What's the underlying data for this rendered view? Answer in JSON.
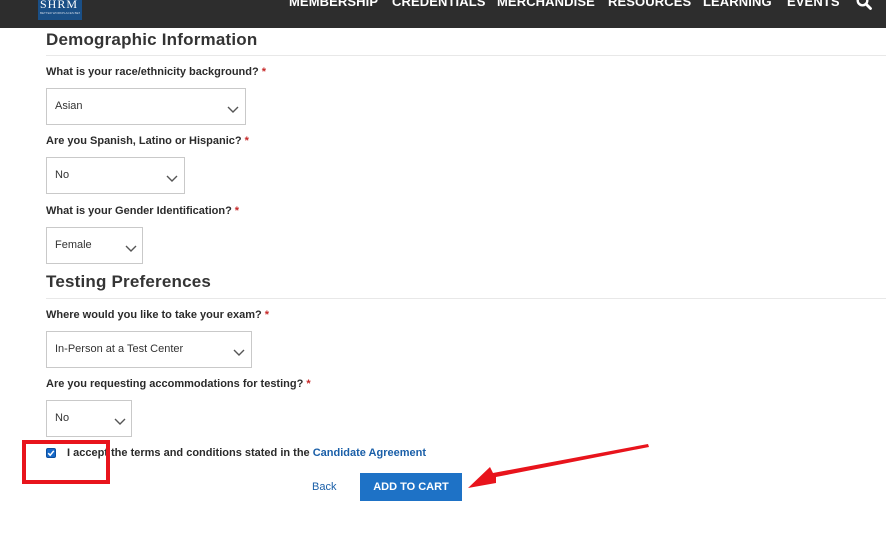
{
  "header": {
    "logo_text": "SHRM",
    "logo_tagline": "BETTER WORKPLACES BETTER WORLD",
    "nav": [
      {
        "label": "MEMBERSHIP"
      },
      {
        "label": "CREDENTIALS"
      },
      {
        "label": "MERCHANDISE"
      },
      {
        "label": "RESOURCES"
      },
      {
        "label": "LEARNING"
      },
      {
        "label": "EVENTS"
      }
    ],
    "search_icon": "search-icon"
  },
  "demographic": {
    "title": "Demographic Information",
    "race": {
      "label": "What is your race/ethnicity background?",
      "value": "Asian"
    },
    "hispanic": {
      "label": "Are you Spanish, Latino or Hispanic?",
      "value": "No"
    },
    "gender": {
      "label": "What is your Gender Identification?",
      "value": "Female"
    }
  },
  "testing": {
    "title": "Testing Preferences",
    "location": {
      "label": "Where would you like to take your exam?",
      "value": "In-Person at a Test Center"
    },
    "accommodations": {
      "label": "Are you requesting accommodations for testing?",
      "value": "No"
    }
  },
  "required_marker": "*",
  "agreement": {
    "checked": true,
    "text": "I accept the terms and conditions stated in the",
    "link": "Candidate Agreement"
  },
  "actions": {
    "back": "Back",
    "add_to_cart": "ADD TO CART"
  },
  "colors": {
    "accent": "#1e72c6",
    "link": "#1a5fa8",
    "annotation": "#e8141c",
    "header_bg": "#2d2d2d"
  }
}
